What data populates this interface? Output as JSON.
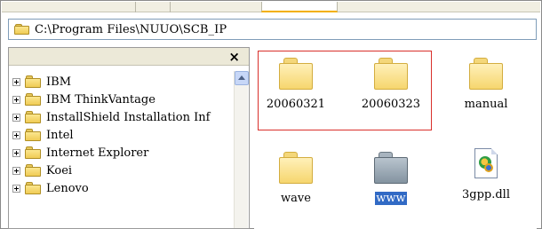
{
  "address_bar": {
    "path": "C:\\Program Files\\NUUO\\SCB_IP"
  },
  "folder_tree": {
    "close_glyph": "×",
    "items": [
      {
        "label": "IBM"
      },
      {
        "label": "IBM ThinkVantage"
      },
      {
        "label": "InstallShield Installation Inf"
      },
      {
        "label": "Intel"
      },
      {
        "label": "Internet Explorer"
      },
      {
        "label": "Koei"
      },
      {
        "label": "Lenovo"
      }
    ]
  },
  "files": {
    "items": [
      {
        "label": "20060321",
        "type": "folder",
        "icon": "folder-icon",
        "highlighted_by_box": true
      },
      {
        "label": "20060323",
        "type": "folder",
        "icon": "folder-icon",
        "highlighted_by_box": true
      },
      {
        "label": "manual",
        "type": "folder",
        "icon": "folder-icon"
      },
      {
        "label": "wave",
        "type": "folder",
        "icon": "folder-icon"
      },
      {
        "label": "www",
        "type": "folder",
        "icon": "folder-grey-icon",
        "selected": true
      },
      {
        "label": "3gpp.dll",
        "type": "file",
        "icon": "dll-file-icon"
      }
    ]
  },
  "colors": {
    "selection_highlight": "#316ac5",
    "annotation_box": "#d9302b",
    "folder_yellow": "#f6d66e"
  }
}
